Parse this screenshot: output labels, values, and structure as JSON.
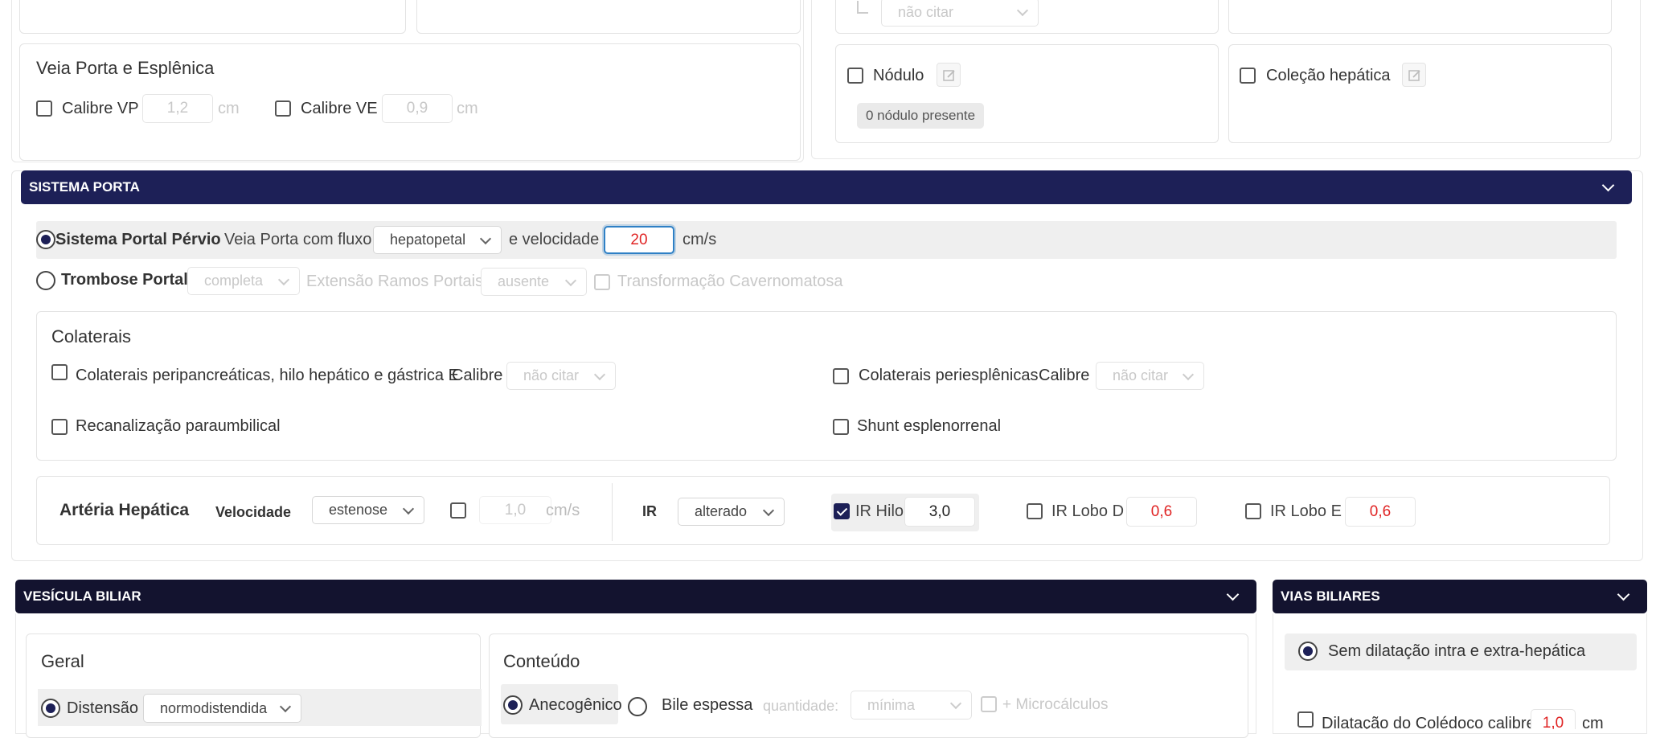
{
  "top": {
    "veia_porta_esplenica": {
      "title": "Veia Porta e Esplênica",
      "calibre_vp_label": "Calibre VP",
      "calibre_vp_value": "1,2",
      "calibre_vp_unit": "cm",
      "calibre_ve_label": "Calibre VE",
      "calibre_ve_value": "0,9",
      "calibre_ve_unit": "cm"
    },
    "nao_citar_select": "não citar",
    "nodulo": {
      "label": "Nódulo",
      "badge": "0 nódulo presente"
    },
    "colecao": {
      "label": "Coleção hepática"
    }
  },
  "sistema_porta": {
    "header": "SISTEMA PORTA",
    "pervio_label": "Sistema Portal Pérvio",
    "veia_porta_fluxo_label": "Veia Porta com fluxo",
    "fluxo_value": "hepatopetal",
    "velocidade_label": "e velocidade",
    "velocidade_value": "20",
    "velocidade_unit": "cm/s",
    "trombose_label": "Trombose Portal",
    "trombose_value": "completa",
    "extensao_label": "Extensão Ramos Portais",
    "extensao_value": "ausente",
    "transformacao_label": "Transformação Cavernomatosa",
    "colaterais": {
      "title": "Colaterais",
      "peripancreaticas_label": "Colaterais peripancreáticas, hilo hepático e gástrica E",
      "calibre_label": "Calibre",
      "peripancreaticas_calibre": "não citar",
      "periesplenicas_label": "Colaterais periesplênicas",
      "periesplenicas_calibre": "não citar",
      "recanalizacao_label": "Recanalização paraumbilical",
      "shunt_label": "Shunt esplenorrenal"
    },
    "arteria": {
      "title": "Artéria Hepática",
      "velocidade_label": "Velocidade",
      "velocidade_select": "estenose",
      "velocidade_value": "1,0",
      "velocidade_unit": "cm/s",
      "ir_label": "IR",
      "ir_select": "alterado",
      "ir_hilo_label": "IR Hilo",
      "ir_hilo_value": "3,0",
      "ir_lobo_d_label": "IR Lobo D",
      "ir_lobo_d_value": "0,6",
      "ir_lobo_e_label": "IR Lobo E",
      "ir_lobo_e_value": "0,6"
    }
  },
  "vesicula": {
    "header": "VESÍCULA BILIAR",
    "geral_title": "Geral",
    "distensao_label": "Distensão",
    "distensao_value": "normodistendida",
    "conteudo_title": "Conteúdo",
    "anecogenico_label": "Anecogênico",
    "bile_label": "Bile espessa",
    "quantidade_label": "quantidade:",
    "quantidade_value": "mínima",
    "microcalculos_label": "+ Microcálculos"
  },
  "vias_biliares": {
    "header": "VIAS BILIARES",
    "sem_dilatacao_label": "Sem dilatação intra e extra-hepática",
    "dilatacao_label": "Dilatação do Colédoco calibre",
    "dilatacao_value": "1,0",
    "dilatacao_unit": "cm"
  },
  "colors": {
    "navy": "#1d2057",
    "dark": "#13132f",
    "red": "#e02424",
    "focus_blue": "#2f80c5"
  }
}
